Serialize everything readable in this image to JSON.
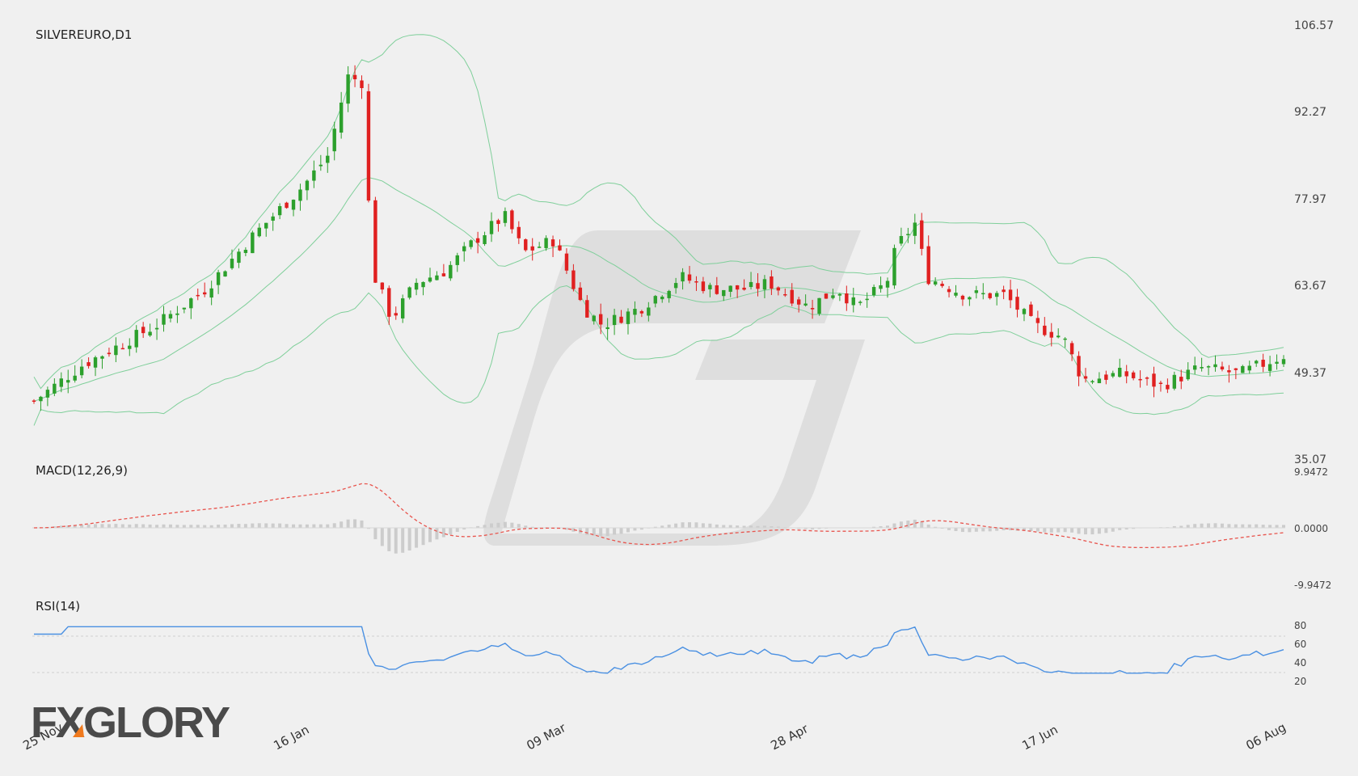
{
  "header": {
    "symbol": "SILVEREURO,D1"
  },
  "logo": {
    "text": "FXGLORY"
  },
  "chart_data": [
    {
      "type": "candlestick",
      "title": "SILVEREURO,D1",
      "ylim": [
        35.07,
        106.57
      ],
      "yticks": [
        "106.57",
        "92.27",
        "77.97",
        "63.67",
        "49.37",
        "35.07"
      ],
      "xticks": [
        "25 Nov",
        "16 Jan",
        "09 Mar",
        "28 Apr",
        "17 Jun",
        "06 Aug"
      ],
      "colors": {
        "up": "#2ca02c",
        "down": "#e02020",
        "band": "#7fcf9a"
      },
      "bollinger": true
    },
    {
      "type": "line",
      "title": "MACD(12,26,9)",
      "ylim": [
        -9.9472,
        9.9472
      ],
      "yticks": [
        "9.9472",
        "0.0000",
        "-9.9472"
      ],
      "colors": {
        "signal": "#e8554e",
        "histogram": "#cccccc"
      }
    },
    {
      "type": "line",
      "title": "RSI(14)",
      "ylim": [
        20,
        80
      ],
      "yticks": [
        "80",
        "60",
        "40",
        "20"
      ],
      "levels": [
        30,
        70
      ],
      "colors": {
        "line": "#4a90e2"
      }
    }
  ]
}
